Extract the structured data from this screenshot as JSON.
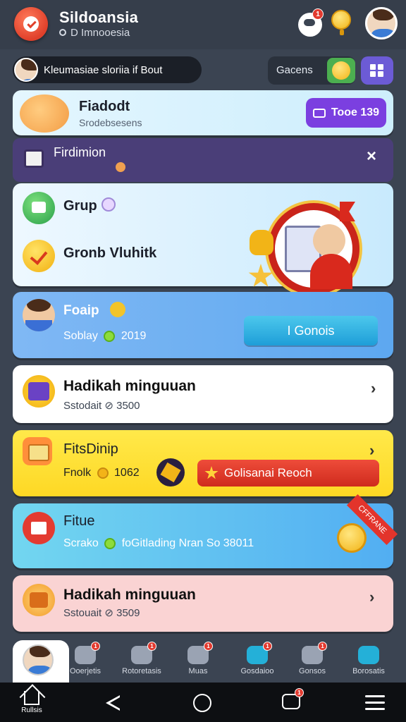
{
  "header": {
    "title": "Sildoansia",
    "subtitle": "D Imnooesia",
    "notif_count": "1"
  },
  "search": {
    "text": "Kleumasiae sloriia if Bout"
  },
  "games": {
    "label": "Gacens"
  },
  "profile_card": {
    "title": "Fiadodt",
    "subtitle": "Srodebsesens",
    "button": "Tooe 139"
  },
  "banner": {
    "title": "Firdimion",
    "close": "×"
  },
  "groups": {
    "item1": "Grup",
    "item2": "Gronb Vluhitk"
  },
  "blue_card": {
    "title": "Foaip",
    "sub_label": "Soblay",
    "sub_value": "2019",
    "button": "I Gonois"
  },
  "white_card": {
    "title": "Hadikah minguuan",
    "sub_label": "Sstodait",
    "sub_value": "3500"
  },
  "yellow_card": {
    "title": "FitsDinip",
    "sub_label": "Fnolk",
    "sub_value": "1062",
    "button": "Golisanai Reoch"
  },
  "cyan_card": {
    "title": "Fitue",
    "sub_label": "Scrako",
    "sub_value": "foGitlading Nran So 38011",
    "ribbon": "CFFRANE"
  },
  "pink_card": {
    "title": "Hadikah minguuan",
    "sub_label": "Sstouait",
    "sub_value": "3509"
  },
  "tabs": [
    {
      "label": "Ooerjetis",
      "badge": "1"
    },
    {
      "label": "Rotoretasis",
      "badge": "1"
    },
    {
      "label": "Muas",
      "badge": "1"
    },
    {
      "label": "Gosdaioo",
      "badge": "1"
    },
    {
      "label": "Gonsos",
      "badge": "1"
    },
    {
      "label": "Borosatis",
      "badge": ""
    }
  ],
  "sysnav": {
    "home_label": "Rullsis",
    "chat_badge": "1"
  },
  "colors": {
    "accent_purple": "#7b3fe0",
    "alert_red": "#e23a2f",
    "coin_gold": "#f2b417"
  }
}
